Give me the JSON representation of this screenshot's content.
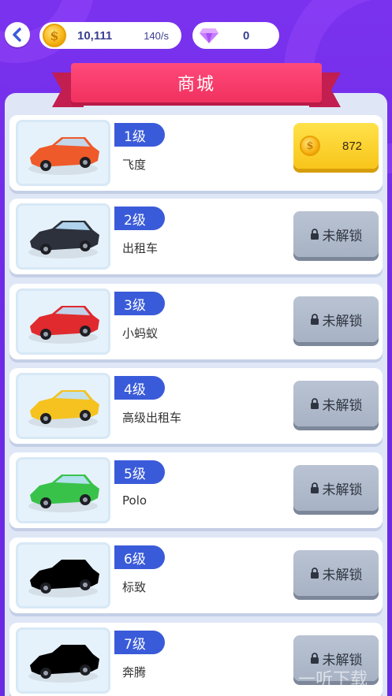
{
  "header": {
    "coins": "10,111",
    "coin_rate": "140/s",
    "gems": "0",
    "back_icon": "chevron-left-icon",
    "coin_icon_symbol": "$"
  },
  "banner": {
    "title": "商城"
  },
  "items": [
    {
      "level": "1级",
      "name": "飞度",
      "price": "872",
      "state": "buy",
      "car_color": "#ef5a2a"
    },
    {
      "level": "2级",
      "name": "出租车",
      "lock_label": "未解锁",
      "state": "locked",
      "car_color": "#2c313c"
    },
    {
      "level": "3级",
      "name": "小蚂蚁",
      "lock_label": "未解锁",
      "state": "locked",
      "car_color": "#e02a2e"
    },
    {
      "level": "4级",
      "name": "高级出租车",
      "lock_label": "未解锁",
      "state": "locked",
      "car_color": "#f5c21f"
    },
    {
      "level": "5级",
      "name": "Polo",
      "lock_label": "未解锁",
      "state": "locked",
      "car_color": "#39c24a"
    },
    {
      "level": "6级",
      "name": "标致",
      "lock_label": "未解锁",
      "state": "locked",
      "car_color": "#000000"
    },
    {
      "level": "7级",
      "name": "奔腾",
      "lock_label": "未解锁",
      "state": "locked",
      "car_color": "#000000"
    }
  ],
  "watermark": {
    "text": "一听下载",
    "icon_char": "听"
  },
  "colors": {
    "background": "#7a32ee",
    "banner": "#f0315f",
    "level_tag": "#3a5bd9",
    "buy_button": "#f8c51a",
    "locked_button": "#a7b2c4"
  }
}
